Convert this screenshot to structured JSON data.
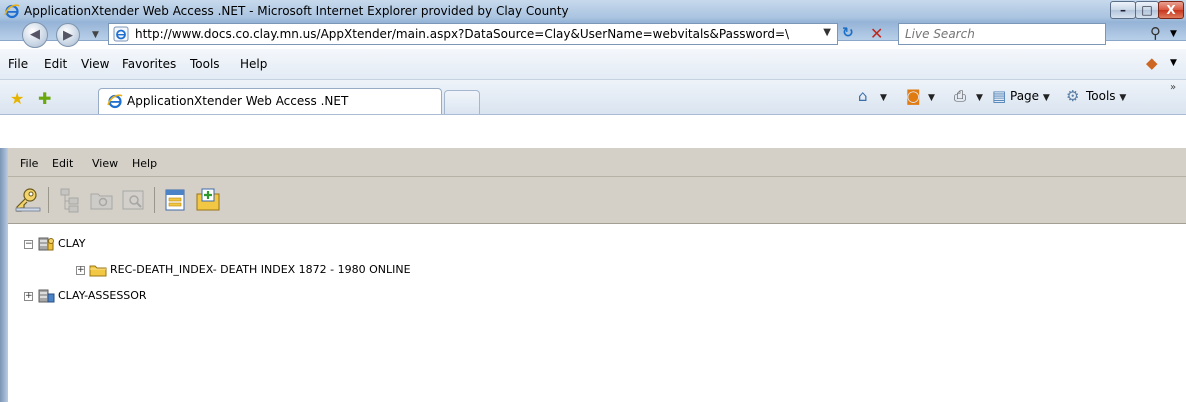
{
  "window": {
    "title": "ApplicationXtender Web Access .NET - Microsoft Internet Explorer provided by Clay County",
    "minimize_glyph": "–",
    "maximize_glyph": "□",
    "close_glyph": "X"
  },
  "address_bar": {
    "url": "http://www.docs.co.clay.mn.us/AppXtender/main.aspx?DataSource=Clay&UserName=webvitals&Password=\\",
    "refresh_glyph": "↻",
    "stop_glyph": "✕"
  },
  "search": {
    "placeholder": "Live Search"
  },
  "ie_menu": [
    "File",
    "Edit",
    "View",
    "Favorites",
    "Tools",
    "Help"
  ],
  "tab": {
    "label": "ApplicationXtender Web Access .NET"
  },
  "command_bar": {
    "page": "Page",
    "tools": "Tools"
  },
  "app_menu": [
    "File",
    "Edit",
    "View",
    "Help"
  ],
  "tree": {
    "root1": "CLAY",
    "child1": "REC-DEATH_INDEX- DEATH INDEX 1872 - 1980 ONLINE",
    "root2": "CLAY-ASSESSOR"
  },
  "colors": {
    "app_chrome": "#d4d0c8",
    "folder": "#f2c744"
  },
  "icons": [
    "ie-icon",
    "back-icon",
    "forward-icon",
    "refresh-icon",
    "stop-icon",
    "search-icon",
    "favorites-star-icon",
    "add-favorites-icon",
    "home-icon",
    "rss-icon",
    "print-icon",
    "page-icon",
    "tools-gear-icon",
    "key-login-icon",
    "folder-icon",
    "database-icon"
  ]
}
